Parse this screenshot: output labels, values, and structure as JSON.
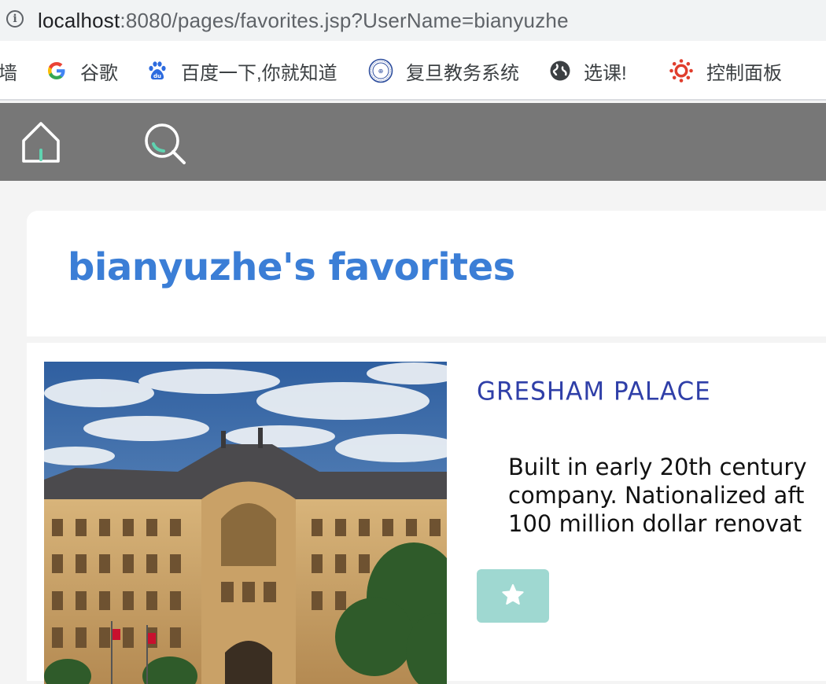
{
  "browser": {
    "url_host": "localhost",
    "url_rest": ":8080/pages/favorites.jsp?UserName=bianyuzhe"
  },
  "bookmarks": [
    {
      "label": "墙",
      "icon": "none"
    },
    {
      "label": "谷歌",
      "icon": "google-icon"
    },
    {
      "label": "百度一下,你就知道",
      "icon": "baidu-icon"
    },
    {
      "label": "复旦教务系统",
      "icon": "fudan-seal-icon"
    },
    {
      "label": "选课!",
      "icon": "globe-icon"
    },
    {
      "label": "控制面板",
      "icon": "canvas-icon"
    }
  ],
  "nav": {
    "home_icon": "home-icon",
    "search_icon": "search-icon"
  },
  "page": {
    "title": "bianyuzhe's favorites"
  },
  "favorite": {
    "name": "GRESHAM PALACE",
    "description_lines": [
      "Built in early 20th century",
      "company. Nationalized aft",
      "100 million dollar renovat"
    ],
    "photo": "photo of Gresham Palace facade under cloudy blue sky",
    "button_icon": "star-icon"
  },
  "colors": {
    "title": "#3b7ed6",
    "item_name": "#2f3fa8",
    "nav_bg": "#777777",
    "fav_button": "#9fd8d1",
    "nav_accent": "#5fd3b0"
  }
}
